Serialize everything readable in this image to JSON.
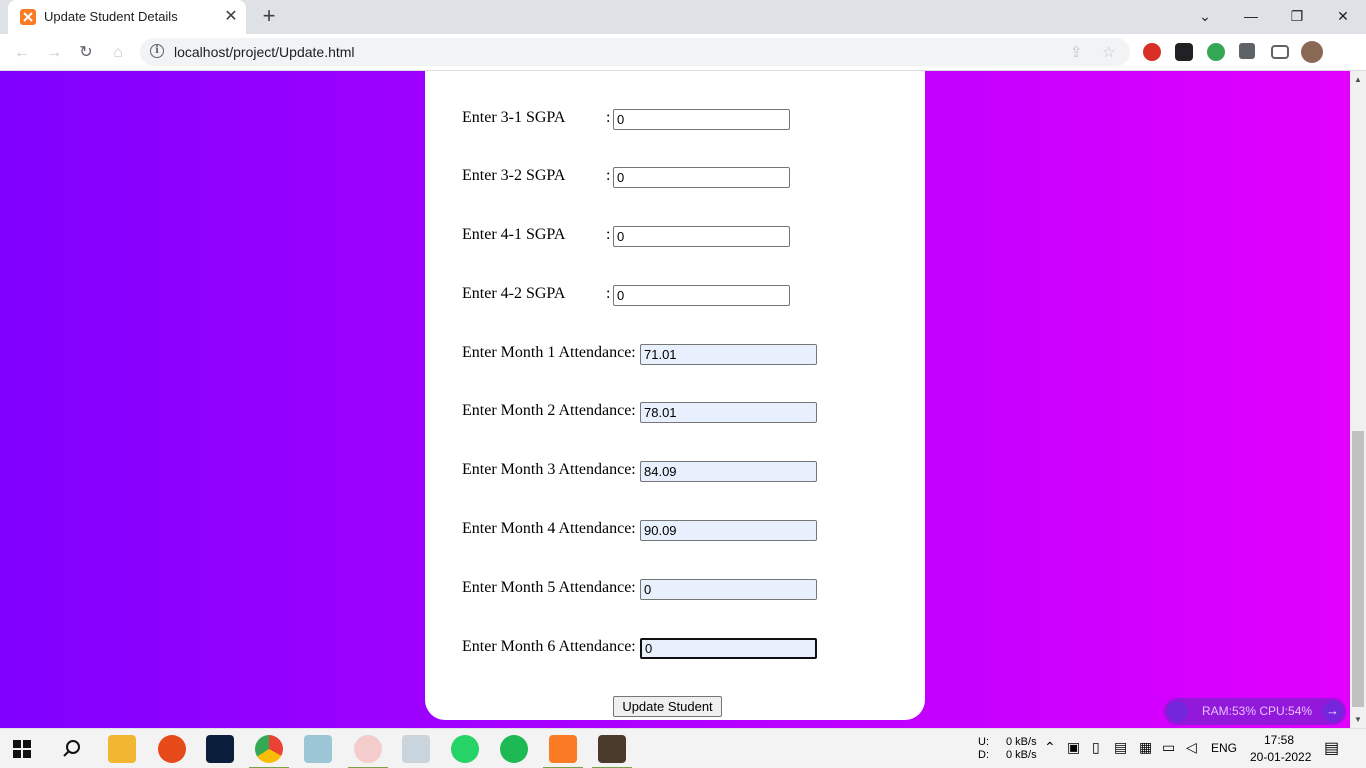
{
  "browser": {
    "tab_title": "Update Student Details",
    "url": "localhost/project/Update.html"
  },
  "form": {
    "sgpa_rows": [
      {
        "label": "Enter 3-1 SGPA",
        "value": "0"
      },
      {
        "label": "Enter 3-2 SGPA",
        "value": "0"
      },
      {
        "label": "Enter 4-1 SGPA",
        "value": "0"
      },
      {
        "label": "Enter 4-2 SGPA",
        "value": "0"
      }
    ],
    "attendance_rows": [
      {
        "label": "Enter Month 1 Attendance:",
        "value": "71.01"
      },
      {
        "label": "Enter Month 2 Attendance:",
        "value": "78.01"
      },
      {
        "label": "Enter Month 3 Attendance:",
        "value": "84.09"
      },
      {
        "label": "Enter Month 4 Attendance:",
        "value": "90.09"
      },
      {
        "label": "Enter Month 5 Attendance:",
        "value": "0"
      },
      {
        "label": "Enter Month 6 Attendance:",
        "value": "0"
      }
    ],
    "colon": ":",
    "submit_label": "Update Student"
  },
  "perf_widget": {
    "text": "RAM:53%   CPU:54%"
  },
  "taskbar": {
    "net_up_label": "U:",
    "net_up_value": "0 kB/s",
    "net_down_label": "D:",
    "net_down_value": "0 kB/s",
    "language": "ENG",
    "time": "17:58",
    "date": "20-01-2022"
  },
  "colors": {
    "gradient_start": "#7f00ff",
    "gradient_end": "#e100ff"
  }
}
